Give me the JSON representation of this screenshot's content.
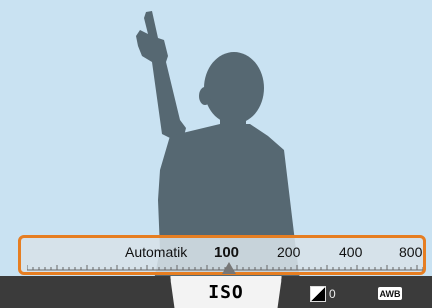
{
  "iso_bar": {
    "mode_label": "Automatik",
    "values": [
      "100",
      "200",
      "400",
      "800"
    ],
    "selected": "100"
  },
  "bottom_bar": {
    "iso_tab": "ISO",
    "ev_value": "0",
    "awb_label": "AWB"
  },
  "colors": {
    "sky": "#c9e2f2",
    "silhouette": "#566872",
    "highlight_border": "#e67e22",
    "bottom_bar": "#3b3b3b"
  }
}
